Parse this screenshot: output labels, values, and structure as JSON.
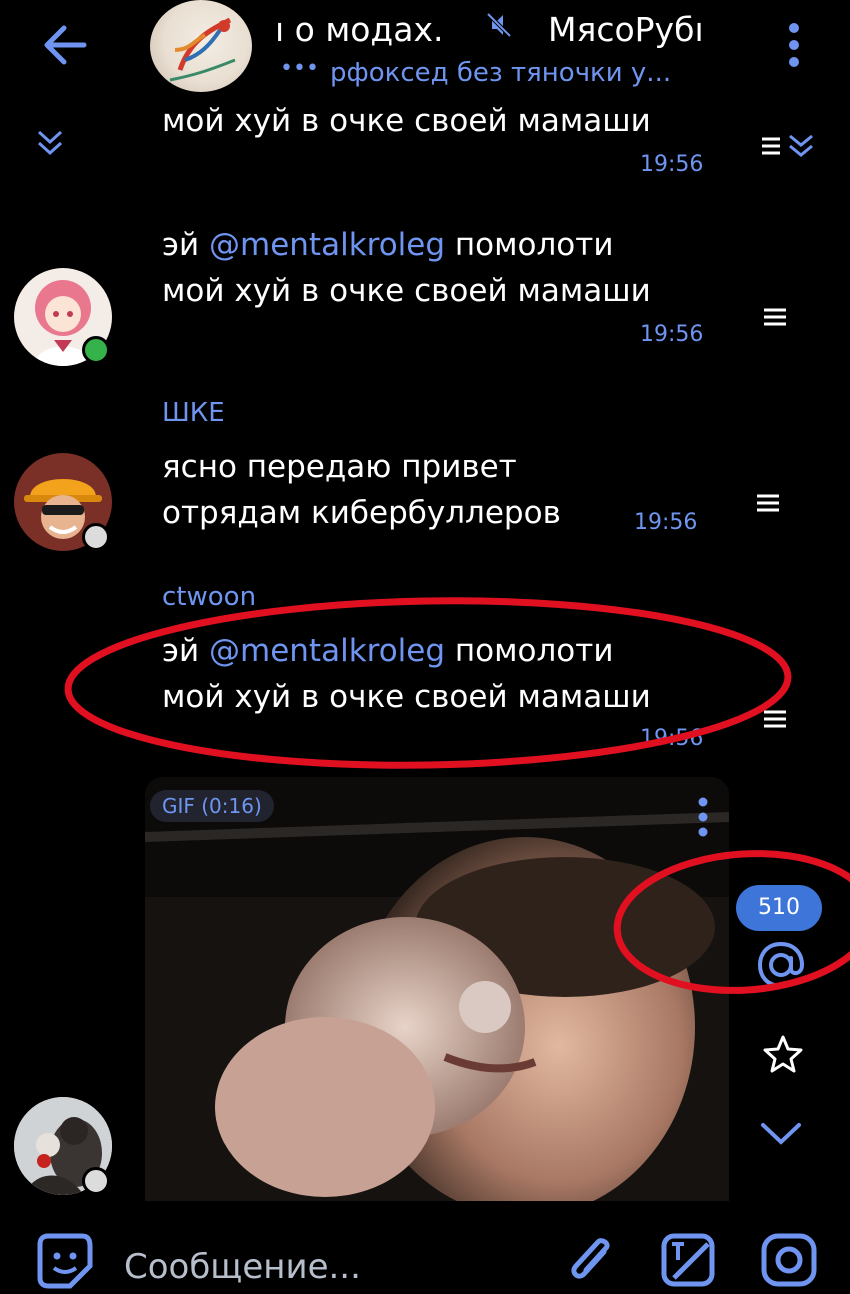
{
  "header": {
    "title": "ı о модах.",
    "title_right": "МясоРубı",
    "typing_indicator": "•••",
    "subtitle": "рфоксед без тяночки у..."
  },
  "messages": [
    {
      "text": "мой хуй в очке своей мамаши",
      "time": "19:56"
    },
    {
      "text_before": "эй ",
      "mention": "@mentalkroleg",
      "text_after": " помолоти",
      "text_line2": "мой хуй в очке своей мамаши",
      "time": "19:56"
    },
    {
      "author": "ШКЕ",
      "line1": "ясно передаю привет",
      "line2": "отрядам кибербуллеров",
      "time": "19:56"
    },
    {
      "author": "ctwoon",
      "text_before": "эй ",
      "mention": "@mentalkroleg",
      "text_after": " помолоти",
      "text_line2": "мой хуй в очке своей мамаши",
      "time": "19:56"
    }
  ],
  "gif": {
    "badge": "GIF (0:16)"
  },
  "side": {
    "unread_count": "510"
  },
  "composer": {
    "placeholder": "Сообщение..."
  },
  "colors": {
    "accent": "#6f95f0",
    "badge": "#3d76d8",
    "annotation": "#e01020",
    "background": "#000000"
  }
}
